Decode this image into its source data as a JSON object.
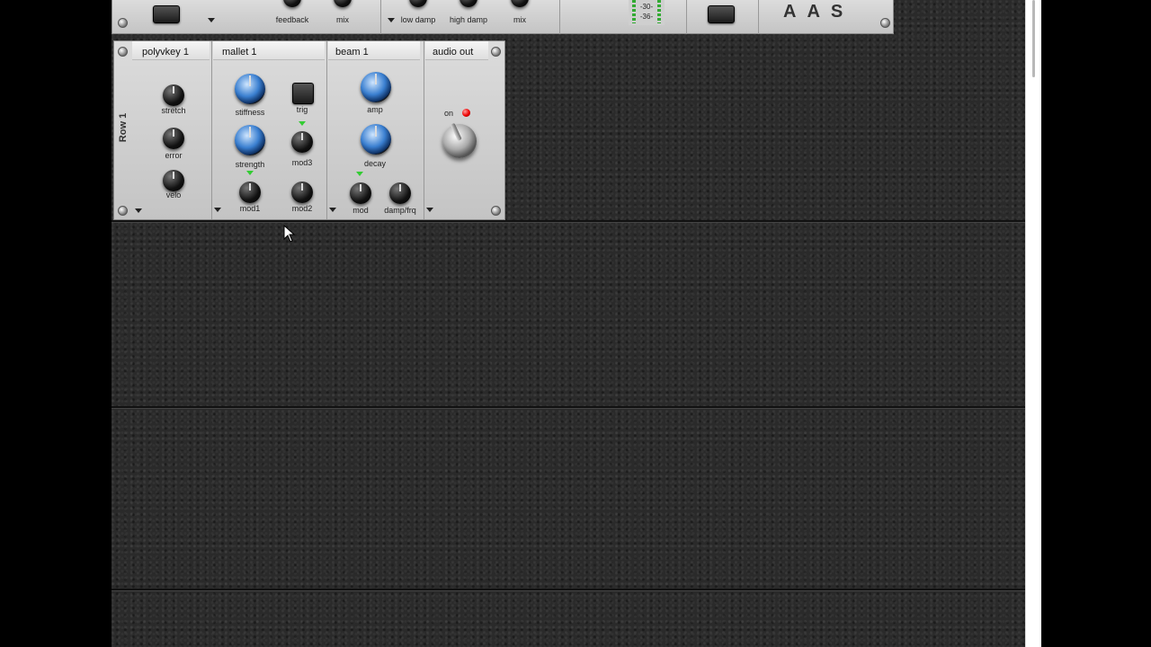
{
  "top_strip": {
    "labels": [
      "feedback",
      "mix",
      "low damp",
      "high damp",
      "mix"
    ],
    "meter_labels": [
      "-30-",
      "-36-"
    ],
    "logo_letters": [
      "A",
      "A",
      "S"
    ]
  },
  "modules": {
    "row_label": "Row 1",
    "polyvkey": {
      "title": "polyvkey 1",
      "knobs": [
        "stretch",
        "error",
        "velo"
      ]
    },
    "mallet": {
      "title": "mallet 1",
      "knobs": [
        "stiffness",
        "strength",
        "mod1",
        "mod2",
        "mod3"
      ],
      "button": "trig"
    },
    "beam": {
      "title": "beam 1",
      "knobs": [
        "amp",
        "decay",
        "mod",
        "damp/frq"
      ]
    },
    "audio_out": {
      "title": "audio out",
      "on_label": "on"
    }
  },
  "colors": {
    "panel": "#d0d0d0",
    "rack_background": "#2a2a2a",
    "knob_accent": "#3a7fd0",
    "led_on": "#ee0000",
    "mod_indicator": "#33cc33"
  },
  "icons": [
    "screw-icon",
    "dropdown-arrow-icon",
    "mouse-cursor-icon",
    "power-led-icon"
  ]
}
